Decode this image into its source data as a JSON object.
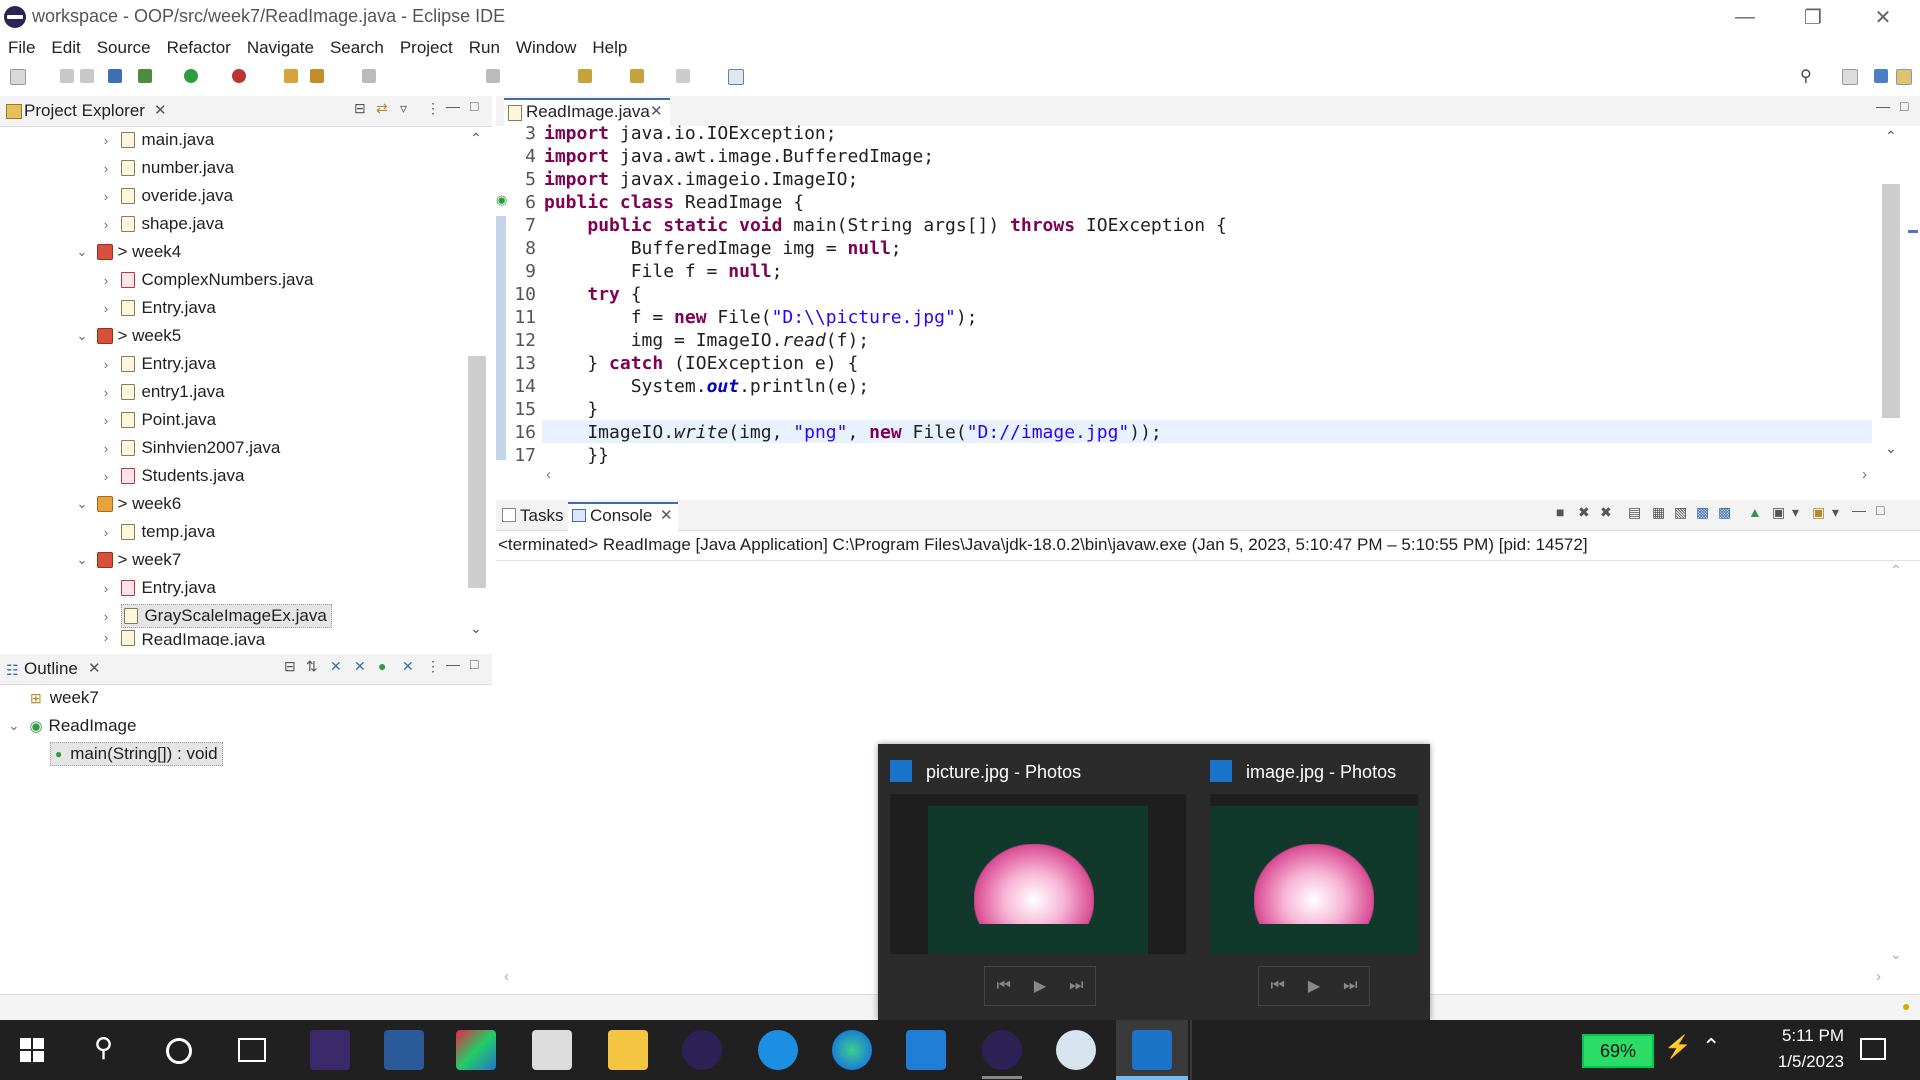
{
  "window": {
    "title": "workspace - OOP/src/week7/ReadImage.java - Eclipse IDE"
  },
  "menu": [
    "File",
    "Edit",
    "Source",
    "Refactor",
    "Navigate",
    "Search",
    "Project",
    "Run",
    "Window",
    "Help"
  ],
  "project_explorer": {
    "tab_label": "Project Explorer",
    "items": [
      {
        "label": "main.java",
        "type": "file"
      },
      {
        "label": "number.java",
        "type": "file"
      },
      {
        "label": "overide.java",
        "type": "file"
      },
      {
        "label": "shape.java",
        "type": "file"
      },
      {
        "label": "> week4",
        "type": "package"
      },
      {
        "label": "ComplexNumbers.java",
        "type": "file-error"
      },
      {
        "label": "Entry.java",
        "type": "file"
      },
      {
        "label": "> week5",
        "type": "package"
      },
      {
        "label": "Entry.java",
        "type": "file"
      },
      {
        "label": "entry1.java",
        "type": "file"
      },
      {
        "label": "Point.java",
        "type": "file"
      },
      {
        "label": "Sinhvien2007.java",
        "type": "file"
      },
      {
        "label": "Students.java",
        "type": "file-error"
      },
      {
        "label": "> week6",
        "type": "package"
      },
      {
        "label": "temp.java",
        "type": "file"
      },
      {
        "label": "> week7",
        "type": "package"
      },
      {
        "label": "Entry.java",
        "type": "file-error"
      },
      {
        "label": "GrayScaleImageEx.java",
        "type": "file-selected"
      },
      {
        "label": "ReadImage.java",
        "type": "file-cut"
      }
    ]
  },
  "outline": {
    "tab_label": "Outline",
    "items": [
      {
        "label": "week7"
      },
      {
        "label": "ReadImage"
      },
      {
        "label": "main(String[]) : void"
      }
    ]
  },
  "editor": {
    "tab_label": "ReadImage.java",
    "lines": [
      {
        "n": "3",
        "text": "import java.io.IOException;"
      },
      {
        "n": "4",
        "text": "import java.awt.image.BufferedImage;"
      },
      {
        "n": "5",
        "text": "import javax.imageio.ImageIO;"
      },
      {
        "n": "6",
        "text": "public class ReadImage {"
      },
      {
        "n": "7",
        "text": "    public static void main(String args[]) throws IOException {"
      },
      {
        "n": "8",
        "text": "        BufferedImage img = null;"
      },
      {
        "n": "9",
        "text": "        File f = null;"
      },
      {
        "n": "10",
        "text": "    try {"
      },
      {
        "n": "11",
        "text": "        f = new File(\"D:\\\\picture.jpg\");"
      },
      {
        "n": "12",
        "text": "        img = ImageIO.read(f);"
      },
      {
        "n": "13",
        "text": "    } catch (IOException e) {"
      },
      {
        "n": "14",
        "text": "        System.out.println(e);"
      },
      {
        "n": "15",
        "text": "    }"
      },
      {
        "n": "16",
        "text": "    ImageIO.write(img, \"png\", new File(\"D://image.jpg\"));"
      },
      {
        "n": "17",
        "text": "    }}"
      }
    ]
  },
  "console": {
    "tabs": [
      "Tasks",
      "Console"
    ],
    "status": "<terminated> ReadImage [Java Application] C:\\Program Files\\Java\\jdk-18.0.2\\bin\\javaw.exe  (Jan 5, 2023, 5:10:47 PM – 5:10:55 PM) [pid: 14572]"
  },
  "thumbnails": [
    {
      "title": "picture.jpg - Photos"
    },
    {
      "title": "image.jpg - Photos"
    }
  ],
  "taskbar": {
    "battery": "69%",
    "time": "5:11 PM",
    "date": "1/5/2023"
  },
  "colors": {
    "keyword": "#7f0055",
    "string": "#2a00ff",
    "taskbar": "#202020"
  }
}
